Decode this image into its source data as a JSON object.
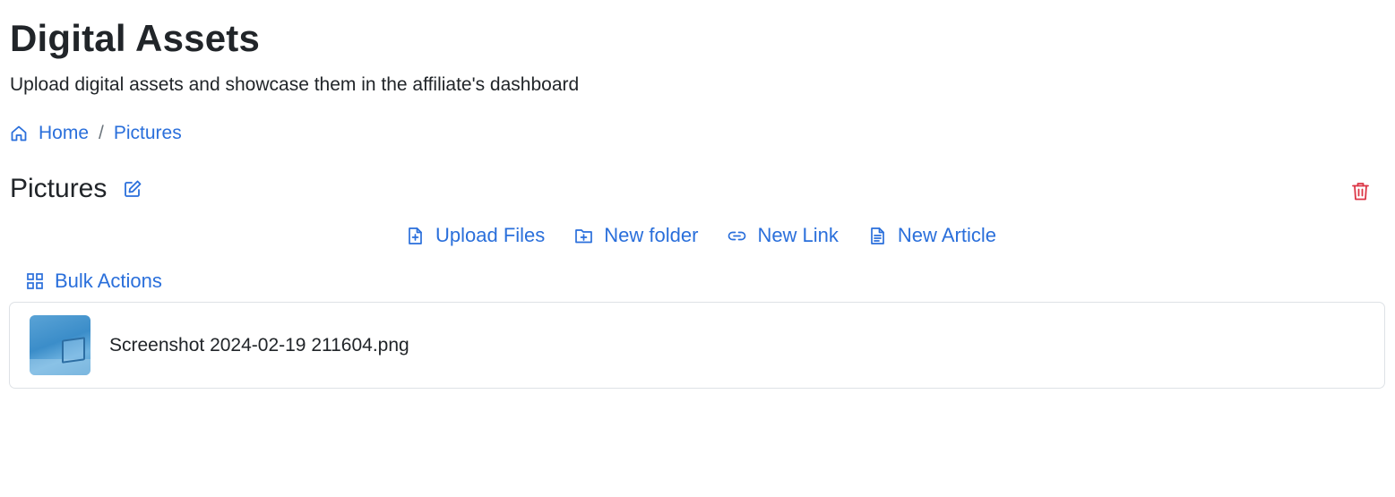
{
  "header": {
    "title": "Digital Assets",
    "subtitle": "Upload digital assets and showcase them in the affiliate's dashboard"
  },
  "breadcrumb": {
    "home_icon": "home-icon",
    "items": [
      {
        "label": "Home"
      },
      {
        "label": "Pictures"
      }
    ],
    "separator": "/"
  },
  "folder": {
    "name": "Pictures",
    "edit_icon": "edit-icon",
    "delete_icon": "trash-icon"
  },
  "actions": [
    {
      "label": "Upload Files",
      "icon": "file-plus-icon"
    },
    {
      "label": "New folder",
      "icon": "folder-plus-icon"
    },
    {
      "label": "New Link",
      "icon": "link-icon"
    },
    {
      "label": "New Article",
      "icon": "document-icon"
    }
  ],
  "bulk_actions": {
    "label": "Bulk Actions",
    "icon": "grid-icon"
  },
  "files": [
    {
      "name": "Screenshot 2024-02-19 211604.png",
      "thumbnail": "image-thumbnail"
    }
  ],
  "colors": {
    "accent": "#2a6fdb",
    "danger": "#dc3545",
    "text": "#212529",
    "border": "#dee2e6"
  }
}
